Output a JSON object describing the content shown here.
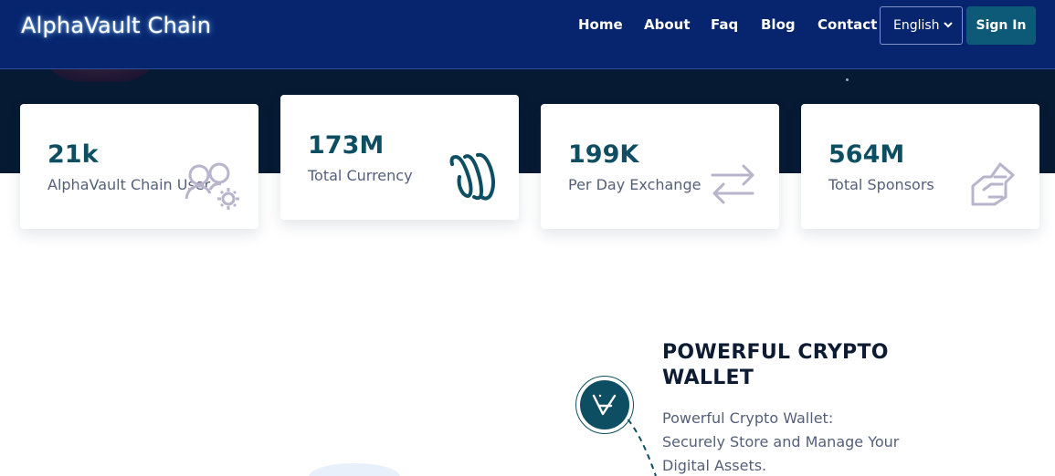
{
  "header": {
    "brand": "AlphaVault Chain",
    "nav": {
      "home": "Home",
      "about": "About",
      "faq": "Faq",
      "blog": "Blog",
      "contact": "Contact"
    },
    "language": {
      "selected": "English"
    },
    "sign_in": "Sign In"
  },
  "stats": [
    {
      "value": "21k",
      "label": "AlphaVault Chain User",
      "icon": "users-gear-icon"
    },
    {
      "value": "173M",
      "label": "Total Currency",
      "icon": "currency-icon"
    },
    {
      "value": "199K",
      "label": "Per Day Exchange",
      "icon": "exchange-arrows-icon"
    },
    {
      "value": "564M",
      "label": "Total Sponsors",
      "icon": "handshake-icon"
    }
  ],
  "feature": {
    "title": "POWERFUL CRYPTO WALLET",
    "text": "Powerful Crypto Wallet: Securely Store and Manage Your Digital Assets.",
    "icon": "vechain-logo-icon"
  },
  "colors": {
    "header_bg": "#06256e",
    "hero_bg": "#061a33",
    "accent_teal": "#0d4e62",
    "signin_bg": "#0d5a78",
    "icon_muted": "#b8b4cc"
  }
}
